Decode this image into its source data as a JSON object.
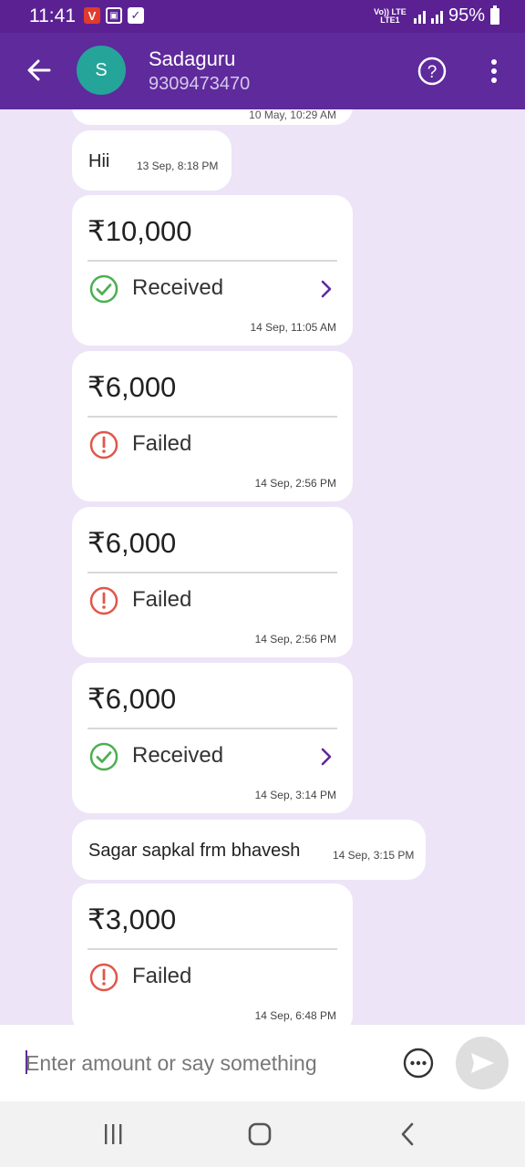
{
  "status_bar": {
    "time": "11:41",
    "network": "Vo)) LTE LTE1",
    "battery": "95%"
  },
  "header": {
    "avatar_initial": "S",
    "contact_name": "Sadaguru",
    "phone": "9309473470"
  },
  "messages": [
    {
      "type": "partial",
      "time": "10 May, 10:29 AM"
    },
    {
      "type": "text",
      "text": "Hii",
      "time": "13 Sep, 8:18 PM"
    },
    {
      "type": "payment",
      "amount": "₹10,000",
      "status": "Received",
      "time": "14 Sep, 11:05 AM"
    },
    {
      "type": "payment",
      "amount": "₹6,000",
      "status": "Failed",
      "time": "14 Sep, 2:56 PM"
    },
    {
      "type": "payment",
      "amount": "₹6,000",
      "status": "Failed",
      "time": "14 Sep, 2:56 PM"
    },
    {
      "type": "payment",
      "amount": "₹6,000",
      "status": "Received",
      "time": "14 Sep, 3:14 PM"
    },
    {
      "type": "text",
      "text": "Sagar sapkal frm bhavesh",
      "time": "14 Sep, 3:15 PM"
    },
    {
      "type": "payment",
      "amount": "₹3,000",
      "status": "Failed",
      "time": "14 Sep, 6:48 PM"
    }
  ],
  "input": {
    "placeholder": "Enter amount or say something",
    "value": ""
  },
  "colors": {
    "header": "#5e2a9c",
    "chat_bg": "#ede4f7",
    "received": "#4caf50",
    "failed": "#e0574a",
    "avatar": "#25a499"
  }
}
